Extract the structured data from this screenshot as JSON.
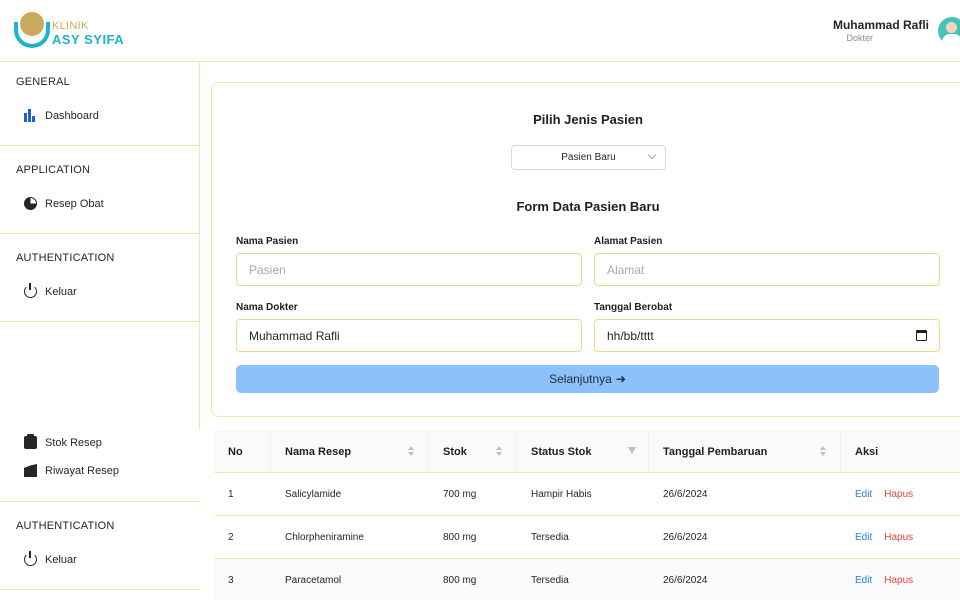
{
  "header": {
    "brand_top": "KLINIK",
    "brand_main": "ASY SYIFA",
    "user_name": "Muhammad Rafli",
    "user_role": "Dokter"
  },
  "sidebar": {
    "groups": [
      {
        "title": "GENERAL",
        "items": [
          {
            "label": "Dashboard",
            "icon": "dashboard-icon"
          }
        ]
      },
      {
        "title": "APPLICATION",
        "items": [
          {
            "label": "Resep Obat",
            "icon": "pie-chart-icon"
          }
        ]
      },
      {
        "title": "AUTHENTICATION",
        "items": [
          {
            "label": "Keluar",
            "icon": "power-icon"
          }
        ]
      }
    ],
    "lower_items": [
      {
        "label": "Stok Resep",
        "icon": "clipboard-icon"
      },
      {
        "label": "Riwayat Resep",
        "icon": "history-icon"
      }
    ],
    "lower_group": {
      "title": "AUTHENTICATION",
      "items": [
        {
          "label": "Keluar",
          "icon": "power-icon"
        }
      ]
    }
  },
  "form": {
    "patient_type_title": "Pilih Jenis Pasien",
    "patient_type_selected": "Pasien Baru",
    "form_title": "Form Data Pasien Baru",
    "fields": {
      "nama_pasien": {
        "label": "Nama Pasien",
        "placeholder": "Pasien",
        "value": ""
      },
      "alamat_pasien": {
        "label": "Alamat Pasien",
        "placeholder": "Alamat",
        "value": ""
      },
      "nama_dokter": {
        "label": "Nama Dokter",
        "value": "Muhammad Rafli"
      },
      "tanggal_berobat": {
        "label": "Tanggal Berobat",
        "value": "hh/bb/tttt"
      }
    },
    "next_button": "Selanjutnya",
    "next_arrow": "➔"
  },
  "table": {
    "columns": [
      "No",
      "Nama Resep",
      "Stok",
      "Status Stok",
      "Tanggal Pembaruan",
      "Aksi"
    ],
    "rows": [
      {
        "no": "1",
        "nama": "Salicylamide",
        "stok": "700 mg",
        "status": "Hampir Habis",
        "tanggal": "26/6/2024"
      },
      {
        "no": "2",
        "nama": "Chlorpheniramine",
        "stok": "800 mg",
        "status": "Tersedia",
        "tanggal": "26/6/2024"
      },
      {
        "no": "3",
        "nama": "Paracetamol",
        "stok": "800 mg",
        "status": "Tersedia",
        "tanggal": "26/6/2024"
      }
    ],
    "edit_label": "Edit",
    "delete_label": "Hapus"
  },
  "colors": {
    "accent_blue": "#1f7ce8",
    "danger_red": "#e8463c",
    "brand_teal": "#1fb3c9",
    "brand_gold": "#c8ab5c",
    "border_yellow": "#f5e7a8",
    "button_blue": "#8cc2f9"
  }
}
